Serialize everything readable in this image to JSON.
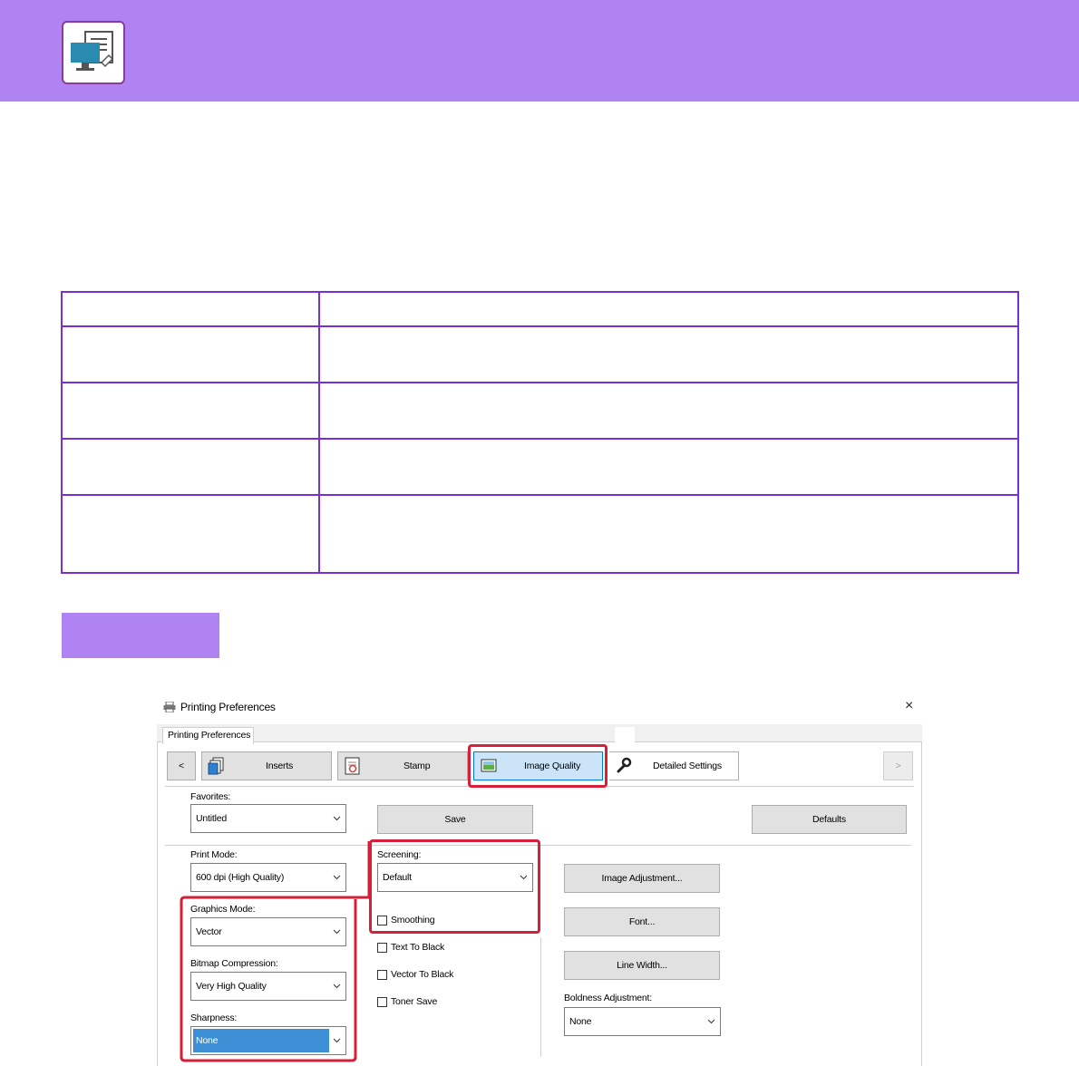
{
  "dialog": {
    "title": "Printing Preferences",
    "close_glyph": "×",
    "tab_label": "Printing Preferences",
    "nav": {
      "prev": "<",
      "next": ">",
      "inserts": "Inserts",
      "stamp": "Stamp",
      "image_quality": "Image Quality",
      "detailed_settings": "Detailed Settings"
    },
    "favorites": {
      "label": "Favorites:",
      "value": "Untitled"
    },
    "save_label": "Save",
    "defaults_label": "Defaults",
    "print_mode": {
      "label": "Print Mode:",
      "value": "600 dpi (High Quality)"
    },
    "screening": {
      "label": "Screening:",
      "value": "Default"
    },
    "smoothing_label": "Smoothing",
    "graphics_mode": {
      "label": "Graphics Mode:",
      "value": "Vector"
    },
    "bitmap_compression": {
      "label": "Bitmap Compression:",
      "value": "Very High Quality"
    },
    "sharpness": {
      "label": "Sharpness:",
      "value": "None"
    },
    "text_to_black_label": "Text To Black",
    "vector_to_black_label": "Vector To Black",
    "toner_save_label": "Toner Save",
    "image_adjustment_label": "Image Adjustment...",
    "font_label": "Font...",
    "line_width_label": "Line Width...",
    "boldness": {
      "label": "Boldness Adjustment:",
      "value": "None"
    }
  },
  "colors": {
    "banner": "#b083f2",
    "table_border": "#7a2fd0",
    "highlight_red": "#d6203a",
    "selected_tab": "#cce4f7"
  }
}
